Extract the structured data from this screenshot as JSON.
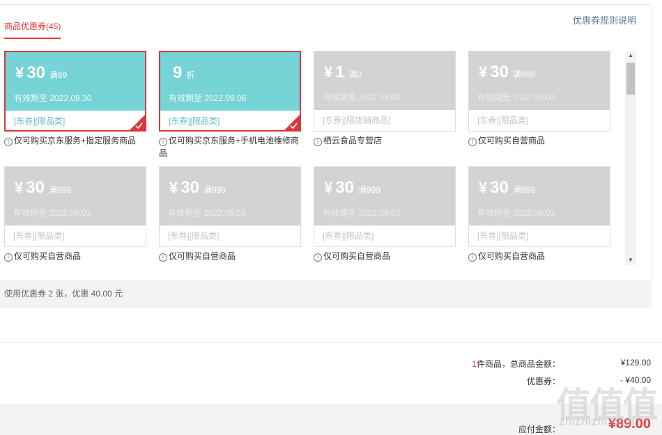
{
  "tab": {
    "label": "商品优惠券(45)"
  },
  "rules_link": "优惠券规则说明",
  "colors": {
    "active": "#76d3d6",
    "inactive": "#d3d3d3",
    "accent": "#e4393c",
    "selected_border": "#d9393c"
  },
  "coupons": [
    {
      "yen": "¥",
      "amount": "30",
      "cond": "满69",
      "valid": "有效期至 2022.09.30",
      "tags": "[东券][限品类]",
      "note": "仅可购买京东服务+指定服务商品",
      "active": true,
      "selected": true
    },
    {
      "yen": "",
      "amount": "9",
      "cond": "折",
      "valid": "有效期至 2022.09.06",
      "tags": "[东券][限品类]",
      "note": "仅可购买京东服务+手机电池维修商品",
      "active": true,
      "selected": true
    },
    {
      "yen": "¥",
      "amount": "1",
      "cond": "满2",
      "valid": "有效期至 2022.09.03",
      "tags": "[东券][限店铺商品]",
      "note": "栖云食品专营店",
      "active": false,
      "selected": false
    },
    {
      "yen": "¥",
      "amount": "30",
      "cond": "满999",
      "valid": "有效期至 2022.09.03",
      "tags": "[东券][限品类]",
      "note": "仅可购买自营商品",
      "active": false,
      "selected": false
    },
    {
      "yen": "¥",
      "amount": "30",
      "cond": "满999",
      "valid": "有效期至 2022.09.03",
      "tags": "[东券][限品类]",
      "note": "仅可购买自营商品",
      "active": false,
      "selected": false
    },
    {
      "yen": "¥",
      "amount": "30",
      "cond": "满999",
      "valid": "有效期至 2022.09.03",
      "tags": "[东券][限品类]",
      "note": "仅可购买自营商品",
      "active": false,
      "selected": false
    },
    {
      "yen": "¥",
      "amount": "30",
      "cond": "满999",
      "valid": "有效期至 2022.09.03",
      "tags": "[东券][限品类]",
      "note": "仅可购买自营商品",
      "active": false,
      "selected": false
    },
    {
      "yen": "¥",
      "amount": "30",
      "cond": "满999",
      "valid": "有效期至 2022.09.03",
      "tags": "[东券][限品类]",
      "note": "仅可购买自营商品",
      "active": false,
      "selected": false
    }
  ],
  "summary": "使用优惠券 2 张，优惠 40.00 元",
  "totals": {
    "count": "1",
    "count_label": "件商品，总商品金额：",
    "goods_amount": "¥129.00",
    "coupon_label": "优惠券：",
    "coupon_amount": "- ¥40.00",
    "pay_label": "应付金额：",
    "pay_amount": "¥89.00"
  },
  "watermark": {
    "glyph": "值",
    "text": "zhizhizhi.com"
  }
}
